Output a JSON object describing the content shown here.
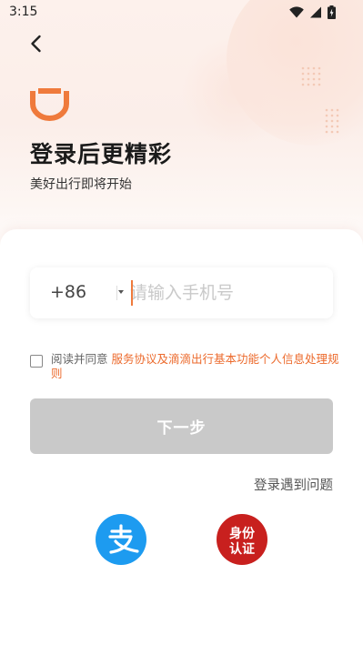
{
  "status_bar": {
    "time": "3:15"
  },
  "header": {
    "title": "登录后更精彩",
    "subtitle": "美好出行即将开始"
  },
  "phone": {
    "country_code": "+86",
    "placeholder": "请输入手机号",
    "value": ""
  },
  "agreement": {
    "prefix": "阅读并同意",
    "links_text": "服务协议及滴滴出行基本功能个人信息处理规则",
    "checked": false
  },
  "next_button": {
    "label": "下一步"
  },
  "help_link": {
    "label": "登录遇到问题"
  },
  "third_party": {
    "alipay_icon": "alipay-icon",
    "id_auth_line1": "身份",
    "id_auth_line2": "认证"
  },
  "colors": {
    "accent": "#ef7a3c",
    "link": "#ec6a2c",
    "button_disabled": "#c9c9c9",
    "alipay": "#1d9bf0",
    "id_auth": "#c8201e"
  }
}
